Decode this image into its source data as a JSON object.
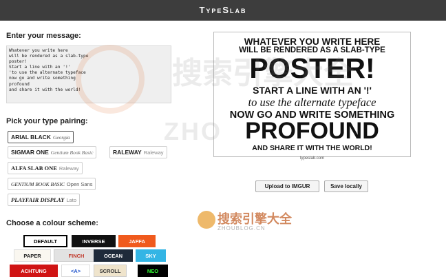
{
  "app": {
    "title": "TypeSlab"
  },
  "message": {
    "label": "Enter your message:",
    "text": "Whatever you write here\nwill be rendered as a slab-type\nposter!\nStart a line with an '!'\n'to use the alternate typeface\nnow go and write something\nprofound\nand share it with the world!"
  },
  "pairing": {
    "label": "Pick your type pairing:",
    "options": [
      {
        "primary": "ARIAL BLACK",
        "secondary": "Georgia"
      },
      {
        "primary": "SIGMAR ONE",
        "secondary": "Gentium Book Basic"
      },
      {
        "primary": "RALEWAY",
        "secondary": "Raleway"
      },
      {
        "primary": "ALFA SLAB ONE",
        "secondary": "Raleway"
      },
      {
        "primary": "GENTIUM BOOK BASIC",
        "secondary": "Open Sans"
      },
      {
        "primary": "PLAYFAIR DISPLAY",
        "secondary": "Lato"
      }
    ]
  },
  "colour": {
    "label": "Choose a colour scheme:",
    "schemes": [
      {
        "label": "DEFAULT",
        "bg": "#ffffff",
        "fg": "#000000",
        "border": "#000000"
      },
      {
        "label": "INVERSE",
        "bg": "#111111",
        "fg": "#ffffff",
        "border": "#111111"
      },
      {
        "label": "JAFFA",
        "bg": "#f05a1d",
        "fg": "#ffffff",
        "border": "#f05a1d"
      },
      {
        "label": "PAPER",
        "bg": "#faf7f0",
        "fg": "#222222",
        "border": "#dddddd"
      },
      {
        "label": "FINCH",
        "bg": "#e2e2e2",
        "fg": "#c0392b",
        "border": "#cccccc"
      },
      {
        "label": "OCEAN",
        "bg": "#1e2a3a",
        "fg": "#ffffff",
        "border": "#1e2a3a"
      },
      {
        "label": "SKY",
        "bg": "#33b5e5",
        "fg": "#ffffff",
        "border": "#33b5e5"
      },
      {
        "label": "ACHTUNG",
        "bg": "#d01414",
        "fg": "#ffffff",
        "border": "#d01414"
      },
      {
        "label": "<A>",
        "bg": "#ffffff",
        "fg": "#2255cc",
        "border": "#dddddd"
      },
      {
        "label": "SCROLL",
        "bg": "#efe4cc",
        "fg": "#333333",
        "border": "#cccccc"
      },
      {
        "label": "NEO",
        "bg": "#000000",
        "fg": "#33ff33",
        "border": "#000000"
      }
    ]
  },
  "poster": {
    "lines": [
      "WHATEVER YOU WRITE HERE",
      "WILL BE RENDERED AS A SLAB-TYPE",
      "POSTER!",
      "START A LINE WITH AN '!'",
      "to use the alternate typeface",
      "NOW GO AND WRITE SOMETHING",
      "PROFOUND",
      "AND SHARE IT WITH THE WORLD!"
    ],
    "credit": "typeslab.com"
  },
  "actions": {
    "upload": "Upload to IMGUR",
    "save": "Save locally"
  },
  "watermark": {
    "brand": "搜索引擎大全",
    "site": "ZHOUBLOG.CN",
    "bg_site": "ZHO"
  }
}
